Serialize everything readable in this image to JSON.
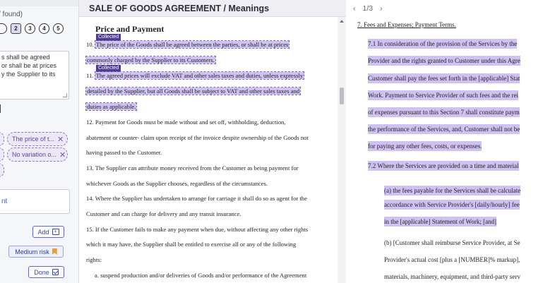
{
  "left_panel": {
    "found_text": "/ found)",
    "steps": [
      "",
      "2",
      "3",
      "4",
      "5"
    ],
    "textarea_lines": [
      "s shall be agreed",
      "or shall be at prices",
      "y the Supplier to its"
    ],
    "chip_1": "The price of t...",
    "chip_2": "No variation o...",
    "box_text": "nt",
    "label_t": "t",
    "add_label": "Add",
    "risk_label": "Medium risk",
    "done_label": "Done"
  },
  "center": {
    "header": "SALE OF GOODS AGREEMENT / Meanings",
    "heading": "Price and Payment",
    "tag_1": "Collected",
    "tag_2": "Collected",
    "lines": [
      "10. The price of the Goods shall be agreed between the parties, or shall be at prices",
      "commonly charged by the Supplier to its Customers.",
      "11. The agreed prices will exclude VAT and other sales taxes and duties, unless expressly",
      "detailed by the Supplier, but all Goods shall be subject to VAT and other sales taxes and",
      "duties as applicable.",
      "12. Payment for Goods must be made without and set off, withholding, deduction,",
      "abatement or counter- claim upon receipt of the invoice despite ownership of the Goods not",
      "having passed to the Customer.",
      "13. The Supplier can attribute money received from the Customer as being payment for",
      "whichever Goods as the Supplier chooses, regardless of the circumstances.",
      "14. Where the Supplier has undertaken to arrange for carriage it shall do so as agent for the",
      "Customer and can charge for delivery and any transit insurance.",
      "15. If the Customer fails to make any payment when due, without affecting any other rights",
      "which it may have, the Supplier shall be entitled to exercise all or any of the following",
      "rights:",
      "a. suspend production and/or deliveries of Goods and/or performance of the Agreement"
    ]
  },
  "right": {
    "page_indicator": "1/3",
    "title": "7. Fees and Expenses; Payment Terms.",
    "lines": [
      "7.1 In consideration of the provision of the Services by the",
      "Provider and the rights granted to Customer under this Agre",
      "Customer shall pay the fees set forth in the [applicable] Stat",
      "Work. Payment to Service Provider of such fees and the rei",
      "of expenses pursuant to this Section 7 shall constitute paym",
      "the performance of the Services, and, Customer shall not be",
      "for paying any other fees, costs, or expenses.",
      "7.2 Where the Services are provided on a time and material",
      "(a) the fees payable for the Services shall be calculate",
      "accordance with Service Provider's [daily/hourly] fee",
      "in the [applicable] Statement of Work; [and]",
      "(b) [Customer shall reimburse Service Provider, at Se",
      "Provider's actual cost [plus a [NUMBER]% markup],",
      "materials, machinery, equipment, and third-party serv"
    ]
  }
}
